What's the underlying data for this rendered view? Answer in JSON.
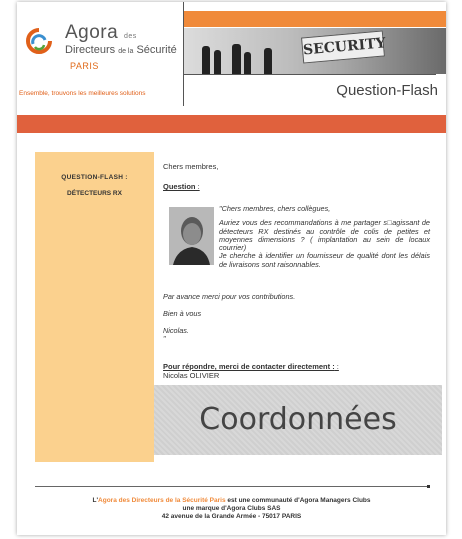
{
  "header": {
    "logo_name": "Agora",
    "logo_des": "des",
    "logo_sub_a": "Directeurs",
    "logo_sub_de": "de la",
    "logo_sub_b": "Sécurité",
    "logo_city": "PARIS",
    "tagline": "Ensemble, trouvons les meilleures solutions",
    "banner_sign": "SECURITY",
    "title": "Question-Flash"
  },
  "sidebar": {
    "title": "QUESTION-FLASH :",
    "subtitle": "DÉTECTEURS RX"
  },
  "content": {
    "greeting": "Chers membres,",
    "question_label": "Question",
    "question_colon": " :",
    "msg_1": "\"Chers membres, chers collègues,",
    "msg_2": "Auriez vous des recommandations à me partager s□agissant de détecteurs RX destinés au contrôle de colis de petites et moyennes dimensions ? ( implantation au sein de locaux courrier)",
    "msg_3": "Je cherche à identifier un fournisseur de qualité dont les délais de livraisons sont raisonnables.",
    "thanks": "Par avance merci pour vos contributions.",
    "bien": "Bien à vous",
    "sign": "Nicolas.",
    "quote_end": "\"",
    "reply_label": "Pour répondre, merci de contacter directement :",
    "reply_colon": " :",
    "reply_name": "Nicolas OLIVIER",
    "coord_label": "Coordonnées"
  },
  "footer": {
    "line1_prefix": "L'",
    "line1_highlight": "Agora des Directeurs de la Sécurité Paris",
    "line1_suffix": " est une communauté d'Agora Managers Clubs",
    "line2": "une marque d'Agora Clubs SAS",
    "line3": "42 avenue de la Grande Armée - 75017 PARIS"
  },
  "colors": {
    "accent_orange": "#f08a3a",
    "band_red": "#e0613d",
    "sidebar_bg": "#fbd18e"
  }
}
